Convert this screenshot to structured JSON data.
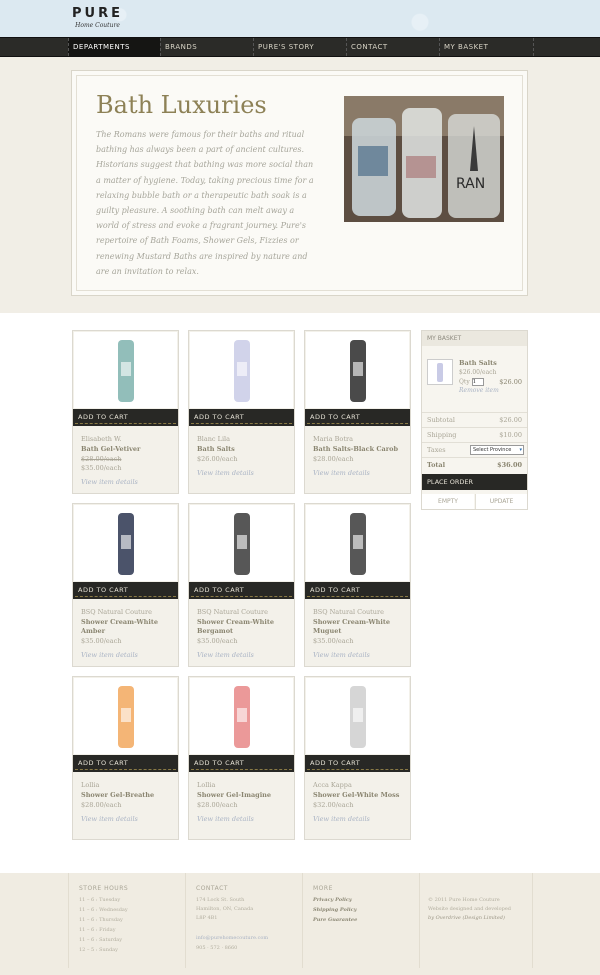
{
  "brand": {
    "name": "PURE",
    "tagline": "Home Couture"
  },
  "nav": [
    "DEPARTMENTS",
    "BRANDS",
    "PURE'S STORY",
    "CONTACT",
    "MY BASKET"
  ],
  "hero": {
    "title": "Bath Luxuries",
    "description": "The Romans were famous for their baths and ritual bathing has always been a part of ancient cultures. Historians suggest that bathing was more social than a matter of hygiene. Today, taking precious time for a relaxing bubble bath or a therapeutic bath soak is a guilty pleasure. A soothing bath can melt away a world of stress and evoke a fragrant journey. Pure's repertoire of Bath Foams, Shower Gels, Fizzies or renewing Mustard Baths are inspired by nature and are an invitation to relax."
  },
  "add_to_cart": "ADD TO CART",
  "view_details": "View item details",
  "products": [
    {
      "brand": "Elisabeth W.",
      "title": "Bath Gel-Vetiver",
      "old_price": "$28.00/each",
      "price": "$35.00/each",
      "color": "#7fb3ae"
    },
    {
      "brand": "Blanc Lila",
      "title": "Bath Salts",
      "price": "$26.00/each",
      "color": "#c9cbe6"
    },
    {
      "brand": "Maria Botra",
      "title": "Bath Salts-Black Carob",
      "price": "$28.00/each",
      "color": "#2a2a2a"
    },
    {
      "brand": "BSQ Natural Couture",
      "title": "Shower Cream-White Amber",
      "price": "$35.00/each",
      "color": "#2b3550"
    },
    {
      "brand": "BSQ Natural Couture",
      "title": "Shower Cream-White Bergamot",
      "price": "$35.00/each",
      "color": "#3a3a3a"
    },
    {
      "brand": "BSQ Natural Couture",
      "title": "Shower Cream-White Muguet",
      "price": "$35.00/each",
      "color": "#3a3a3a"
    },
    {
      "brand": "Lollia",
      "title": "Shower Gel-Breathe",
      "price": "$28.00/each",
      "color": "#f2a85e"
    },
    {
      "brand": "Lollia",
      "title": "Shower Gel-Imagine",
      "price": "$28.00/each",
      "color": "#e88787"
    },
    {
      "brand": "Acca Kappa",
      "title": "Shower Gel-White Moss",
      "price": "$32.00/each",
      "color": "#cfcfcf"
    }
  ],
  "basket": {
    "heading": "MY BASKET",
    "item_name": "Bath Salts",
    "item_price": "$26.00/each",
    "qty_label": "Qty",
    "qty_value": "1",
    "line_total": "$26.00",
    "remove": "Remove item",
    "subtotal_label": "Subtotal",
    "subtotal": "$26.00",
    "shipping_label": "Shipping",
    "shipping": "$10.00",
    "taxes_label": "Taxes",
    "taxes_select": "Select Province",
    "total_label": "Total",
    "total": "$36.00",
    "place_order": "PLACE ORDER",
    "empty": "EMPTY",
    "update": "UPDATE"
  },
  "footer": {
    "hours_heading": "STORE HOURS",
    "hours": [
      "11 – 6 : Tuesday",
      "11 – 6 : Wednesday",
      "11 – 6 : Thursday",
      "11 – 6 : Friday",
      "11 – 6 : Saturday",
      "12 – 5 : Sunday"
    ],
    "contact_heading": "CONTACT",
    "contact": [
      "174 Lock St. South",
      "Hamilton, ON, Canada",
      "L8P 4B1",
      "info@purehomecouture.com",
      "905 · 572 · 8660"
    ],
    "more_heading": "MORE",
    "more": [
      "Privacy Policy",
      "Shipping Policy",
      "Pure Guarantee"
    ],
    "copyright": [
      "© 2011 Pure Home Couture",
      "Website designed and developed",
      "by Overdrive (Design Limited)"
    ]
  }
}
